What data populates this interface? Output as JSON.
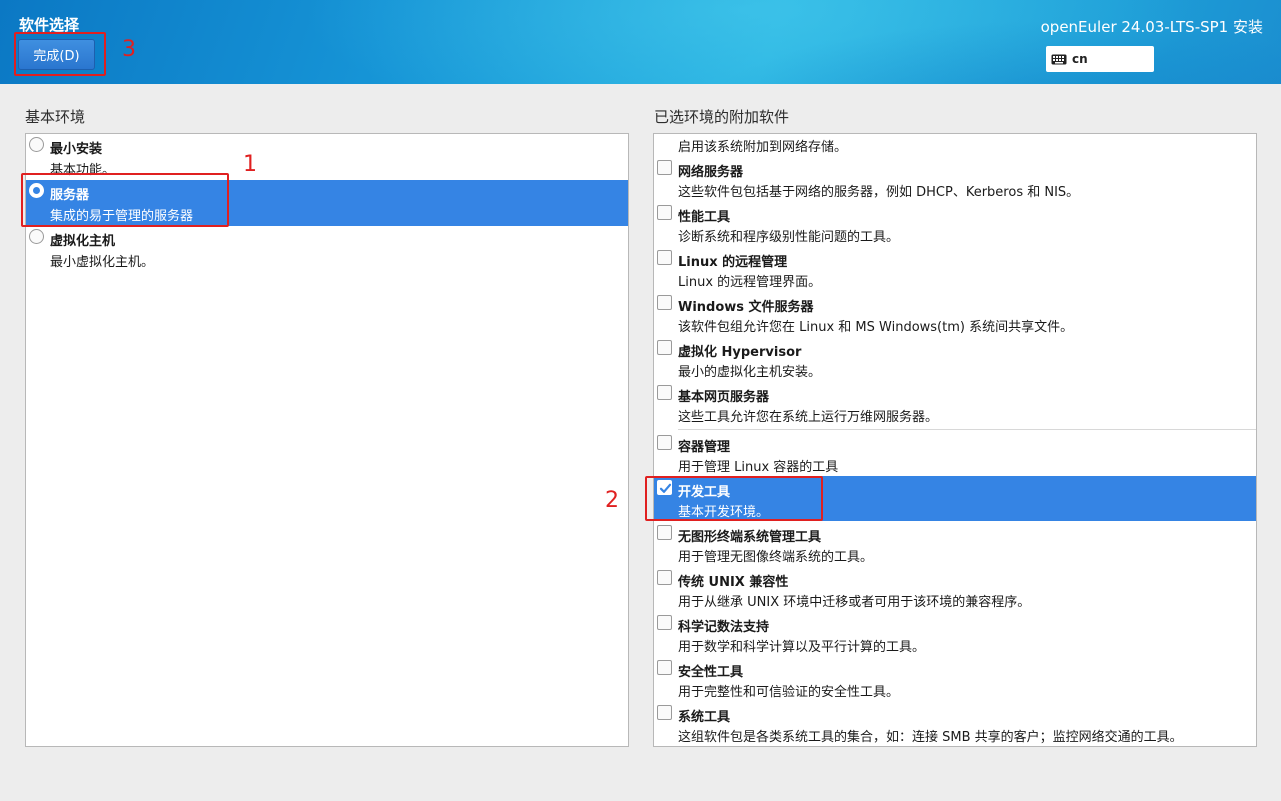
{
  "header": {
    "page_title": "软件选择",
    "done_label": "完成(D)",
    "product_title": "openEuler 24.03-LTS-SP1 安装",
    "keyboard_layout": "cn"
  },
  "annotations": {
    "mark_1": "1",
    "mark_2": "2",
    "mark_3": "3",
    "color": "#e02020"
  },
  "base_environment": {
    "heading": "基本环境",
    "items": [
      {
        "name": "最小安装",
        "desc": "基本功能。",
        "selected": false
      },
      {
        "name": "服务器",
        "desc": "集成的易于管理的服务器",
        "selected": true
      },
      {
        "name": "虚拟化主机",
        "desc": "最小虚拟化主机。",
        "selected": false
      }
    ]
  },
  "addons": {
    "heading": "已选环境的附加软件",
    "partial_top_desc": "启用该系统附加到网络存储。",
    "items": [
      {
        "name": "网络服务器",
        "desc": "这些软件包包括基于网络的服务器，例如 DHCP、Kerberos 和 NIS。",
        "checked": false
      },
      {
        "name": "性能工具",
        "desc": "诊断系统和程序级别性能问题的工具。",
        "checked": false
      },
      {
        "name": "Linux 的远程管理",
        "desc": "Linux 的远程管理界面。",
        "checked": false
      },
      {
        "name": "Windows 文件服务器",
        "desc": "该软件包组允许您在 Linux 和 MS Windows(tm) 系统间共享文件。",
        "checked": false
      },
      {
        "name": "虚拟化 Hypervisor",
        "desc": "最小的虚拟化主机安装。",
        "checked": false
      },
      {
        "name": "基本网页服务器",
        "desc": "这些工具允许您在系统上运行万维网服务器。",
        "checked": false
      },
      {
        "name": "容器管理",
        "desc": "用于管理 Linux 容器的工具",
        "checked": false
      },
      {
        "name": "开发工具",
        "desc": "基本开发环境。",
        "checked": true
      },
      {
        "name": "无图形终端系统管理工具",
        "desc": "用于管理无图像终端系统的工具。",
        "checked": false
      },
      {
        "name": "传统 UNIX 兼容性",
        "desc": "用于从继承 UNIX 环境中迁移或者可用于该环境的兼容程序。",
        "checked": false
      },
      {
        "name": "科学记数法支持",
        "desc": "用于数学和科学计算以及平行计算的工具。",
        "checked": false
      },
      {
        "name": "安全性工具",
        "desc": "用于完整性和可信验证的安全性工具。",
        "checked": false
      },
      {
        "name": "系统工具",
        "desc": "这组软件包是各类系统工具的集合，如：连接 SMB 共享的客户；监控网络交通的工具。",
        "checked": false
      }
    ]
  },
  "colors": {
    "accent": "#3584e4",
    "header_gradient_start": "#0b78c4",
    "header_gradient_end": "#2ab4e2"
  }
}
